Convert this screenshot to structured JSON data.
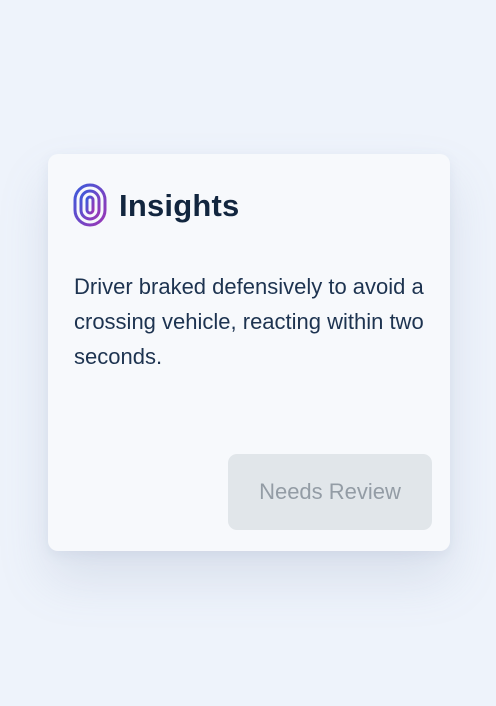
{
  "card": {
    "icon": "fingerprint-icon",
    "title": "Insights",
    "description": "Driver braked defensively to avoid a crossing vehicle, reacting within two seconds.",
    "action_button": {
      "label": "Needs Review",
      "state": "disabled"
    }
  },
  "colors": {
    "background": "#eef3fb",
    "card": "#f7f9fc",
    "title": "#12263f",
    "text": "#1d3350",
    "icon_gradient_start": "#3b5bdb",
    "icon_gradient_end": "#9c36b5",
    "button_background": "#e1e6ea",
    "button_text": "#939ca5"
  }
}
